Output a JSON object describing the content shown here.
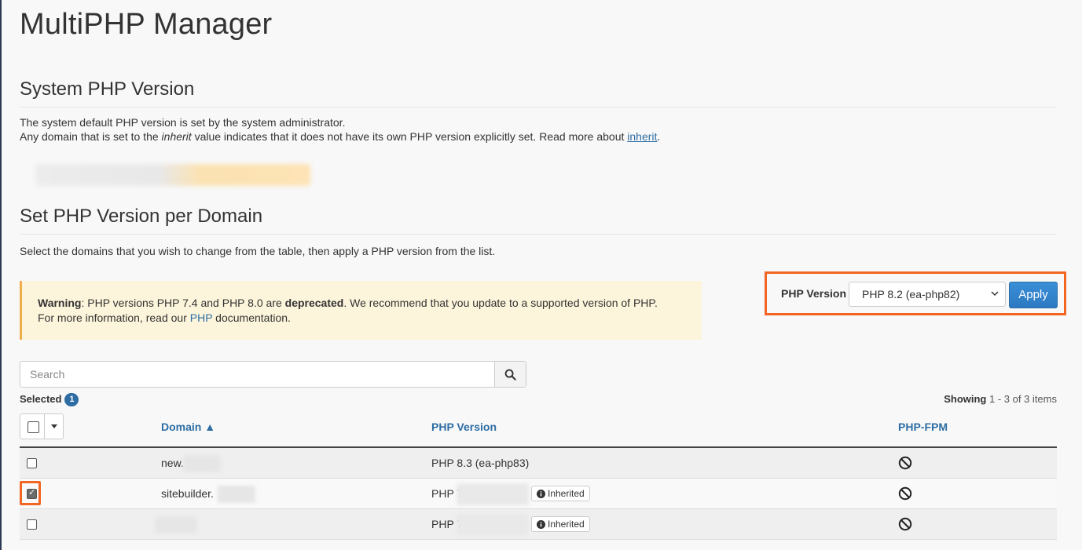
{
  "page": {
    "title": "MultiPHP Manager"
  },
  "system": {
    "title": "System PHP Version",
    "line1": "The system default PHP version is set by the system administrator.",
    "line2_pre": "Any domain that is set to the ",
    "line2_em": "inherit",
    "line2_post": " value indicates that it does not have its own PHP version explicitly set. Read more about ",
    "line2_link": "inherit",
    "line2_end": "."
  },
  "per_domain": {
    "title": "Set PHP Version per Domain",
    "desc": "Select the domains that you wish to change from the table, then apply a PHP version from the list."
  },
  "warning": {
    "label": "Warning",
    "text1": ": PHP versions PHP 7.4 and PHP 8.0 are ",
    "bold": "deprecated",
    "text2": ". We recommend that you update to a supported version of PHP.",
    "text3": "For more information, read our ",
    "link": "PHP",
    "text4": " documentation."
  },
  "php_select": {
    "label": "PHP Version",
    "value": "PHP 8.2 (ea-php82)",
    "apply_label": "Apply"
  },
  "search": {
    "placeholder": "Search"
  },
  "selection": {
    "label": "Selected",
    "count": "1"
  },
  "showing": {
    "label": "Showing",
    "range": "1 - 3",
    "suffix": "of 3 items"
  },
  "table": {
    "headers": {
      "domain": "Domain ▲",
      "php_version": "PHP Version",
      "php_fpm": "PHP-FPM"
    },
    "rows": [
      {
        "domain": "new.",
        "php_version": "PHP 8.3 (ea-php83)",
        "inherited": "",
        "checked": false
      },
      {
        "domain": "sitebuilder.",
        "php_version": "PHP 7",
        "inherited": "Inherited",
        "checked": true
      },
      {
        "domain": "",
        "php_version": "PHP 7",
        "inherited": "Inherited",
        "checked": false
      }
    ]
  },
  "colors": {
    "highlight": "#f26522",
    "link": "#2d6da3",
    "button": "#2c79c2",
    "warning_bg": "#fcf5db",
    "warning_border": "#f0ad4e"
  },
  "icons": {
    "search": "search-icon",
    "fpm_disabled": "ban-icon",
    "info": "info-circle-icon",
    "select": "chevron-down-icon",
    "bulk": "caret-down-icon"
  }
}
